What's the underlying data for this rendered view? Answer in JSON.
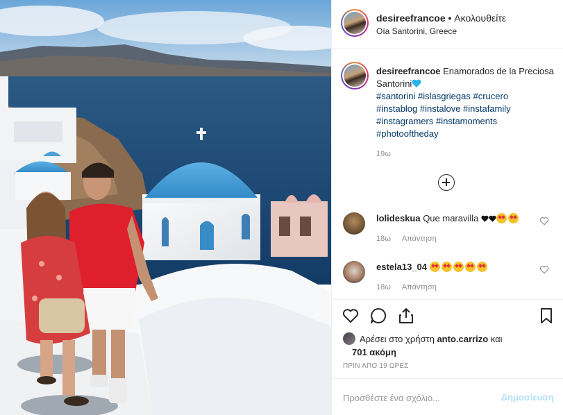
{
  "post": {
    "username": "desireefrancoe",
    "separator": " • ",
    "follow_label": "Ακολουθείτε",
    "location": "Oía Santorini, Greece",
    "photo_icon": "santorini-photo"
  },
  "caption": {
    "username": "desireefrancoe",
    "text": " Enamorados de la Preciosa Santorini",
    "heart_emoji_color": "#2ab3ea",
    "hashtags": [
      "#santorini #islasgriegas #crucero",
      "#instablog #instalove #instafamily",
      "#instagramers #instamoments",
      "#photooftheday"
    ],
    "time": "19ω"
  },
  "comments": [
    {
      "username": "lolideskua",
      "text": " Que maravilla ",
      "emojis": [
        "black-heart",
        "black-heart",
        "heart-eyes-face",
        "heart-eyes-face"
      ],
      "time": "18ω",
      "reply_label": "Απάντηση"
    },
    {
      "username": "estela13_04",
      "text": " ",
      "emojis": [
        "heart-eyes-face",
        "heart-eyes-face",
        "heart-eyes-face",
        "heart-eyes-face",
        "heart-eyes-face"
      ],
      "time": "18ω",
      "reply_label": "Απάντηση"
    }
  ],
  "actions": {
    "icons": [
      "heart-outline-icon",
      "comment-bubble-icon",
      "share-icon",
      "bookmark-icon"
    ]
  },
  "likes": {
    "prefix": "Αρέσει στο χρήστη ",
    "user": "anto.carrizo",
    "middle": " και",
    "count": "701 ακόμη"
  },
  "timestamp": "ΠΡΙΝ ΑΠΟ 19 ΩΡΕΣ",
  "add_comment": {
    "placeholder": "Προσθέστε ένα σχόλιο...",
    "post_label": "Δημοσίευση"
  },
  "colors": {
    "link": "#00376b",
    "muted": "#8e8e8e",
    "post_button_disabled": "#b2dffc",
    "dome_blue": "#3a92cc"
  }
}
